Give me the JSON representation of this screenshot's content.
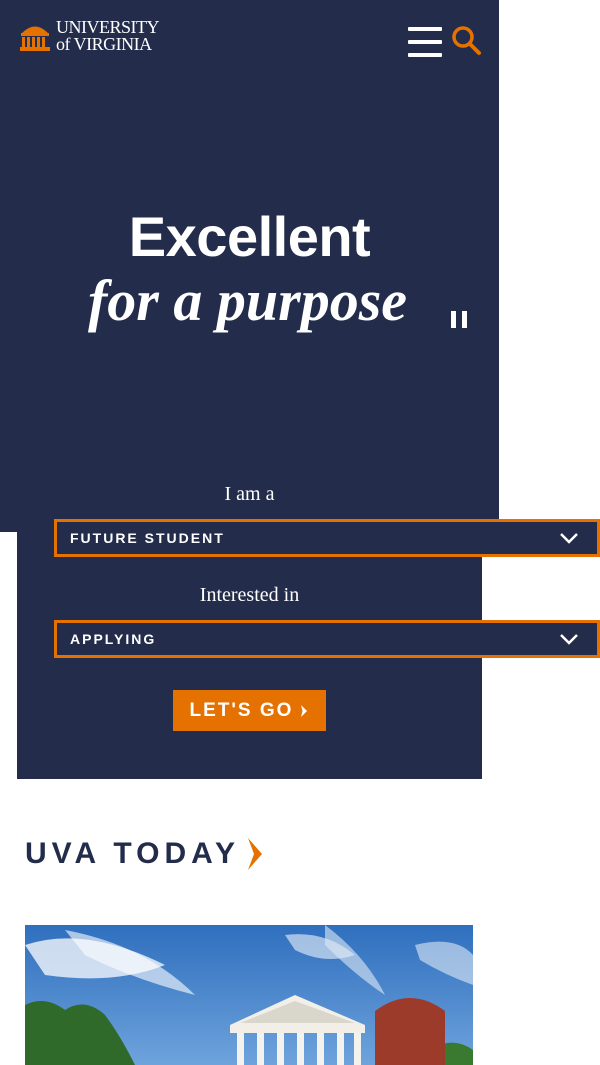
{
  "header": {
    "logo_line1": "UNIVERSITY",
    "logo_line2": "of VIRGINIA",
    "menu_icon": "hamburger-menu-icon",
    "search_icon": "search-icon"
  },
  "hero": {
    "headline_bold": "Excellent",
    "headline_italic": "for a purpose",
    "pause_icon": "pause-icon"
  },
  "selector": {
    "role_label": "I am a",
    "role_value": "FUTURE STUDENT",
    "interest_label": "Interested in",
    "interest_value": "APPLYING",
    "go_label": "LET'S GO"
  },
  "news": {
    "section_title": "UVA TODAY"
  },
  "colors": {
    "navy": "#232d4b",
    "orange": "#e57200",
    "white": "#ffffff"
  }
}
